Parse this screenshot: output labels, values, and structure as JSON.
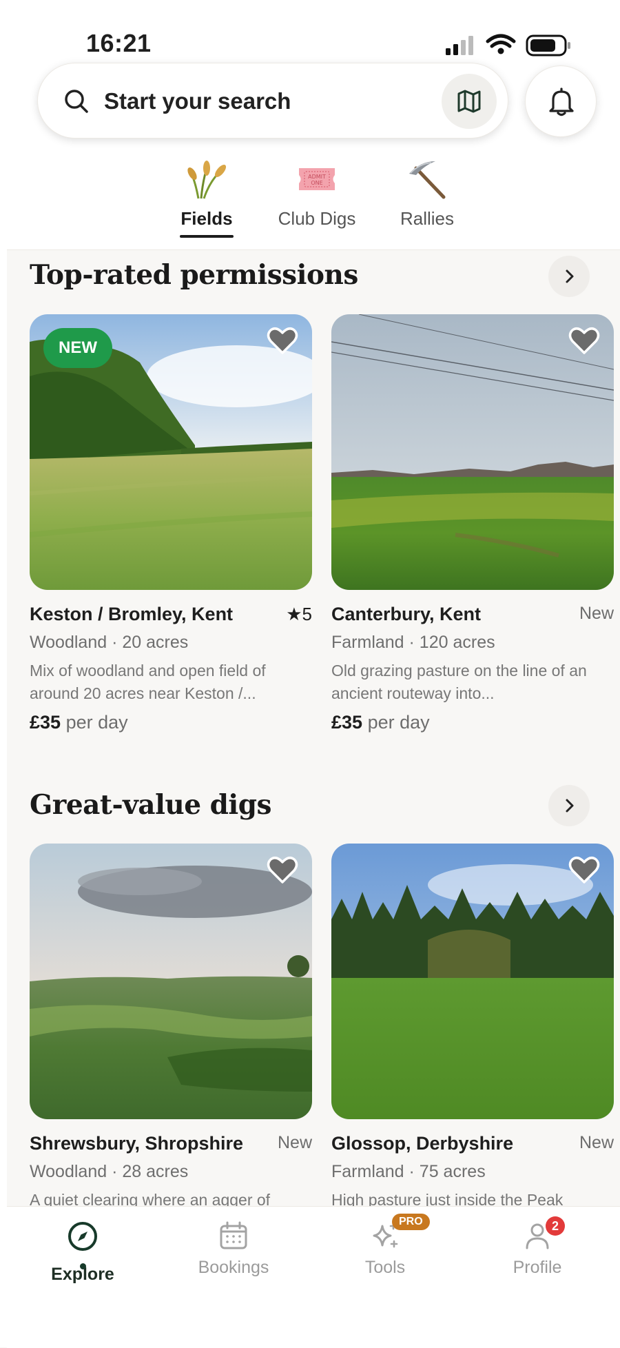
{
  "status_bar": {
    "time": "16:21"
  },
  "search": {
    "placeholder": "Start your search"
  },
  "categories": [
    {
      "label": "Fields",
      "icon": "wheat-icon",
      "active": true
    },
    {
      "label": "Club Digs",
      "icon": "ticket-icon",
      "ticket_text_1": "ADMIT",
      "ticket_text_2": "ONE"
    },
    {
      "label": "Rallies",
      "icon": "pick-icon"
    }
  ],
  "sections": [
    {
      "title": "Top-rated permissions",
      "cards": [
        {
          "badge": "NEW",
          "location": "Keston / Bromley, Kent",
          "rating": "5",
          "subtitle": "Woodland · 20 acres",
          "description": "Mix of woodland and open field of around 20 acres near Keston /...",
          "price": "£35",
          "price_unit": "per day"
        },
        {
          "location": "Canterbury, Kent",
          "status": "New",
          "subtitle": "Farmland · 120 acres",
          "description": "Old grazing pasture on the line of an ancient routeway into...",
          "price": "£35",
          "price_unit": "per day"
        }
      ]
    },
    {
      "title": "Great-value digs",
      "cards": [
        {
          "location": "Shrewsbury, Shropshire",
          "status": "New",
          "subtitle": "Woodland · 28 acres",
          "description": "A quiet clearing where an agger of"
        },
        {
          "location": "Glossop, Derbyshire",
          "status": "New",
          "subtitle": "Farmland · 75 acres",
          "description": "High pasture just inside the Peak"
        }
      ]
    }
  ],
  "tab_bar": [
    {
      "label": "Explore",
      "icon": "compass-icon",
      "active": true
    },
    {
      "label": "Bookings",
      "icon": "calendar-icon"
    },
    {
      "label": "Tools",
      "icon": "sparkles-icon",
      "badge": "PRO"
    },
    {
      "label": "Profile",
      "icon": "user-icon",
      "badge": "2"
    }
  ],
  "colors": {
    "accent_green": "#1f9a4a",
    "pro_badge": "#c8781f",
    "notification_red": "#e23a3a",
    "nav_active": "#173a2a"
  }
}
